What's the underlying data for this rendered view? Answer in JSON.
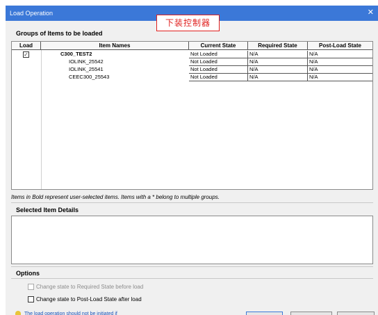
{
  "window": {
    "title": "Load Operation",
    "close_glyph": "✕"
  },
  "annotation": "下装控制器",
  "groups": {
    "title": "Groups of Items to be loaded",
    "columns": [
      "Load",
      "Item Names",
      "Current State",
      "Required State",
      "Post-Load State"
    ],
    "rows": [
      {
        "checked": true,
        "name": "C300_TEST2",
        "bold": true,
        "current": "Not Loaded",
        "required": "N/A",
        "post": "N/A"
      },
      {
        "checked": false,
        "name": "IOLINK_25542",
        "bold": false,
        "current": "Not Loaded",
        "required": "N/A",
        "post": "N/A"
      },
      {
        "checked": false,
        "name": "IOLINK_25541",
        "bold": false,
        "current": "Not Loaded",
        "required": "N/A",
        "post": "N/A"
      },
      {
        "checked": false,
        "name": "CEEC300_25543",
        "bold": false,
        "current": "Not Loaded",
        "required": "N/A",
        "post": "N/A"
      }
    ]
  },
  "note": "Items in Bold represent user-selected items. Items with a * belong to multiple groups.",
  "details": {
    "title": "Selected Item Details"
  },
  "options": {
    "title": "Options",
    "items": [
      {
        "label": "Change state to Required State before load",
        "checked": false,
        "disabled": true
      },
      {
        "label": "Change state to Post-Load State after load",
        "checked": false,
        "disabled": false
      }
    ]
  },
  "footer": {
    "icon": "lightbulb-icon",
    "text": "The load operation should not be initiated if"
  },
  "colors": {
    "titlebar": "#3b78d8",
    "annotation": "#e0201e",
    "link": "#1a52b8"
  }
}
